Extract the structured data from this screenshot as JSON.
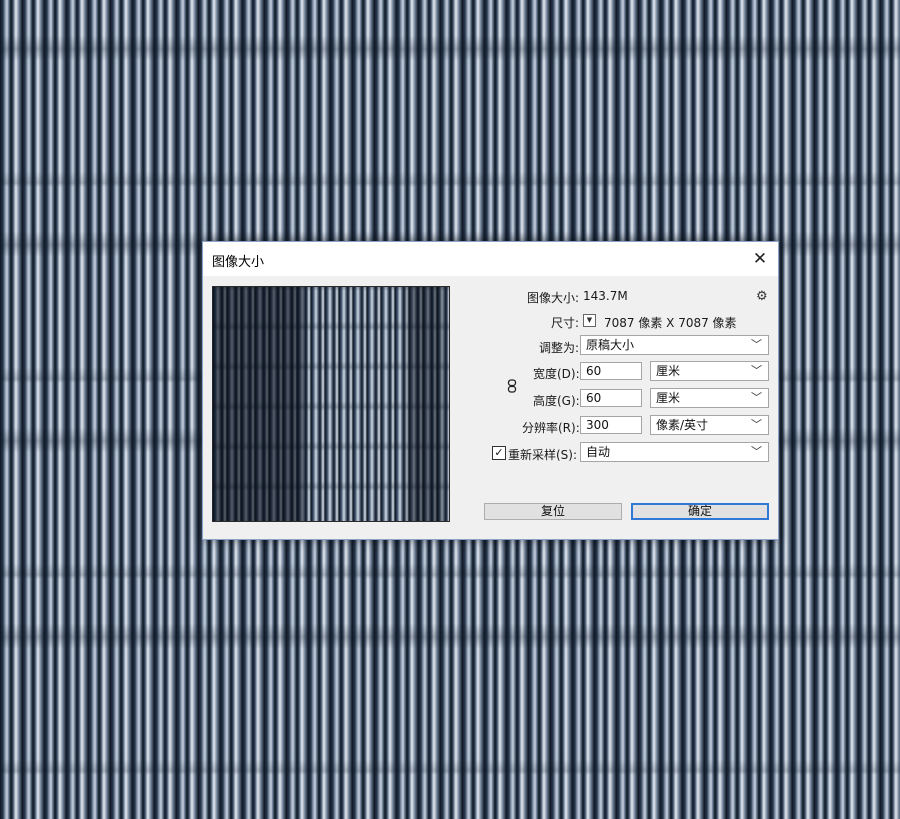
{
  "dialog": {
    "title": "图像大小",
    "close_icon": "close-icon",
    "image_size_label": "图像大小:",
    "image_size_value": "143.7M",
    "settings_icon": "gear-icon",
    "dimensions_label": "尺寸:",
    "dimensions_value": "7087 像素 X 7087 像素",
    "fit_to_label": "调整为:",
    "fit_to_value": "原稿大小",
    "width_label": "宽度(D):",
    "width_value": "60",
    "width_unit": "厘米",
    "height_label": "高度(G):",
    "height_value": "60",
    "height_unit": "厘米",
    "resolution_label": "分辨率(R):",
    "resolution_value": "300",
    "resolution_unit": "像素/英寸",
    "resample_label": "重新采样(S):",
    "resample_checked": true,
    "resample_value": "自动",
    "reset_button": "复位",
    "ok_button": "确定"
  }
}
